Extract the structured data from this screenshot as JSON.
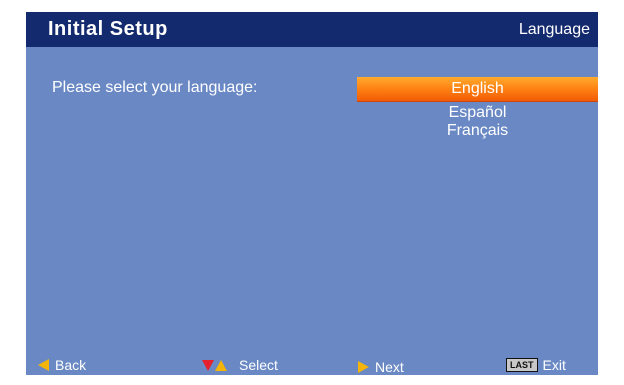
{
  "header": {
    "title": "Initial  Setup",
    "section": "Language"
  },
  "prompt": "Please select your language:",
  "languages": {
    "items": [
      "English",
      "Español",
      "Français"
    ],
    "selected": "English"
  },
  "footer": {
    "back_label": "Back",
    "select_label": "Select",
    "next_label": "Next",
    "exit_key": "LAST",
    "exit_label": "Exit"
  },
  "colors": {
    "background": "#6a89c4",
    "header": "#142a6e",
    "selection": "#ff8515",
    "arrow_yellow": "#f4b40a",
    "arrow_red": "#e5202a"
  }
}
